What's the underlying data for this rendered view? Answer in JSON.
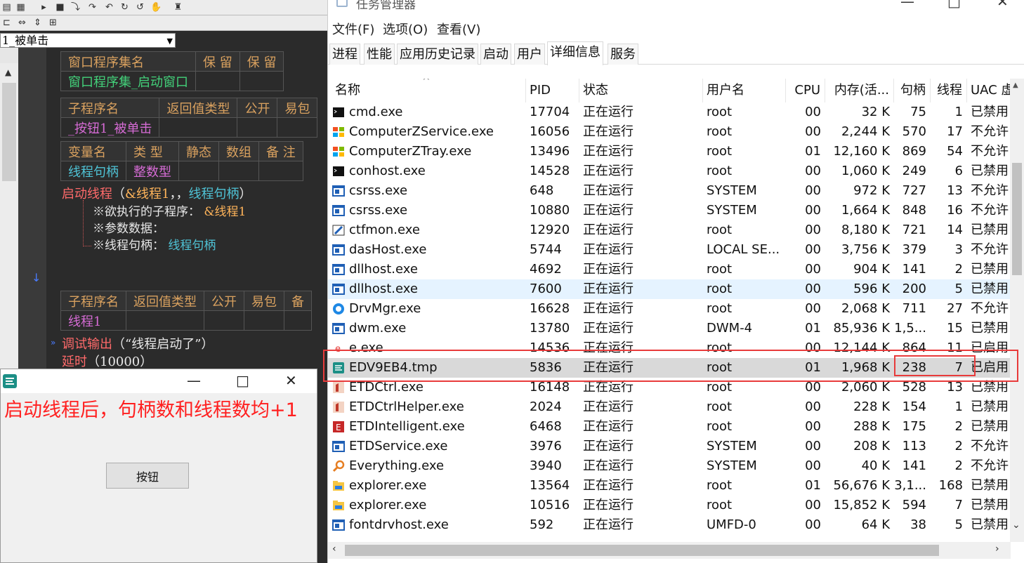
{
  "ide": {
    "combo_value": "1_被单击",
    "table1": {
      "headers": [
        "窗口程序集名",
        "保 留",
        "保 留"
      ],
      "row": [
        "窗口程序集_启动窗口"
      ]
    },
    "table2": {
      "headers": [
        "子程序名",
        "返回值类型",
        "公开",
        "易包"
      ],
      "row": [
        "_按钮1_被单击"
      ]
    },
    "table3": {
      "headers": [
        "变量名",
        "类 型",
        "静态",
        "数组",
        "备 注"
      ],
      "row": [
        "线程句柄",
        "整数型"
      ]
    },
    "code1": {
      "fn": "启动线程",
      "args_open": "（",
      "arg1": "&线程1",
      "sep": "，，",
      "arg2": "线程句柄",
      "args_close": "）"
    },
    "code_p1_label": "※欲执行的子程序：",
    "code_p1_val": "&线程1",
    "code_p2_label": "※参数数据：",
    "code_p3_label": "※线程句柄：",
    "code_p3_val": "线程句柄",
    "table4": {
      "headers": [
        "子程序名",
        "返回值类型",
        "公开",
        "易包",
        "备"
      ],
      "row": [
        "线程1"
      ]
    },
    "code2": {
      "fn": "调试输出",
      "arg": "（“线程启动了”）"
    },
    "code3": {
      "fn": "延时",
      "arg": "（10000）"
    }
  },
  "app_window": {
    "caption": "启动线程后，句柄数和线程数均+1",
    "button_label": "按钮",
    "minimize": "—",
    "maximize": "□",
    "close": "✕"
  },
  "task_manager": {
    "title": "任务管理器",
    "menu": [
      "文件(F)",
      "选项(O)",
      "查看(V)"
    ],
    "tabs": [
      "进程",
      "性能",
      "应用历史记录",
      "启动",
      "用户",
      "详细信息",
      "服务"
    ],
    "active_tab": "详细信息",
    "columns": [
      "名称",
      "PID",
      "状态",
      "用户名",
      "CPU",
      "内存(活...",
      "句柄",
      "线程",
      "UAC 虚"
    ],
    "rows": [
      {
        "name": "cmd.exe",
        "pid": "17704",
        "status": "正在运行",
        "user": "root",
        "cpu": "00",
        "mem": "32 K",
        "handles": "75",
        "threads": "1",
        "uac": "已禁用",
        "icon": "console-icon"
      },
      {
        "name": "ComputerZService.exe",
        "pid": "16056",
        "status": "正在运行",
        "user": "root",
        "cpu": "00",
        "mem": "2,244 K",
        "handles": "570",
        "threads": "17",
        "uac": "不允许",
        "icon": "windows-flag-icon"
      },
      {
        "name": "ComputerZTray.exe",
        "pid": "13496",
        "status": "正在运行",
        "user": "root",
        "cpu": "01",
        "mem": "12,160 K",
        "handles": "869",
        "threads": "54",
        "uac": "不允许",
        "icon": "windows-flag-icon"
      },
      {
        "name": "conhost.exe",
        "pid": "14528",
        "status": "正在运行",
        "user": "root",
        "cpu": "00",
        "mem": "1,060 K",
        "handles": "249",
        "threads": "6",
        "uac": "已禁用",
        "icon": "console-icon"
      },
      {
        "name": "csrss.exe",
        "pid": "648",
        "status": "正在运行",
        "user": "SYSTEM",
        "cpu": "00",
        "mem": "972 K",
        "handles": "727",
        "threads": "13",
        "uac": "不允许",
        "icon": "window-app-icon"
      },
      {
        "name": "csrss.exe",
        "pid": "10880",
        "status": "正在运行",
        "user": "SYSTEM",
        "cpu": "00",
        "mem": "1,664 K",
        "handles": "848",
        "threads": "16",
        "uac": "不允许",
        "icon": "window-app-icon"
      },
      {
        "name": "ctfmon.exe",
        "pid": "12920",
        "status": "正在运行",
        "user": "root",
        "cpu": "00",
        "mem": "8,180 K",
        "handles": "721",
        "threads": "14",
        "uac": "已禁用",
        "icon": "pen-icon"
      },
      {
        "name": "dasHost.exe",
        "pid": "5744",
        "status": "正在运行",
        "user": "LOCAL SE...",
        "cpu": "00",
        "mem": "3,756 K",
        "handles": "379",
        "threads": "3",
        "uac": "不允许",
        "icon": "window-app-icon"
      },
      {
        "name": "dllhost.exe",
        "pid": "4692",
        "status": "正在运行",
        "user": "root",
        "cpu": "00",
        "mem": "904 K",
        "handles": "141",
        "threads": "2",
        "uac": "已禁用",
        "icon": "window-app-icon"
      },
      {
        "name": "dllhost.exe",
        "pid": "7600",
        "status": "正在运行",
        "user": "root",
        "cpu": "00",
        "mem": "596 K",
        "handles": "200",
        "threads": "5",
        "uac": "已禁用",
        "icon": "window-app-icon"
      },
      {
        "name": "DrvMgr.exe",
        "pid": "16628",
        "status": "正在运行",
        "user": "root",
        "cpu": "00",
        "mem": "2,068 K",
        "handles": "711",
        "threads": "27",
        "uac": "不允许",
        "icon": "driver-icon"
      },
      {
        "name": "dwm.exe",
        "pid": "13780",
        "status": "正在运行",
        "user": "DWM-4",
        "cpu": "01",
        "mem": "85,936 K",
        "handles": "1,5...",
        "threads": "15",
        "uac": "已禁用",
        "icon": "window-app-icon"
      },
      {
        "name": "e.exe",
        "pid": "14536",
        "status": "正在运行",
        "user": "root",
        "cpu": "00",
        "mem": "12,144 K",
        "handles": "864",
        "threads": "11",
        "uac": "已启用",
        "icon": "e-lang-icon"
      },
      {
        "name": "EDV9EB4.tmp",
        "pid": "5836",
        "status": "正在运行",
        "user": "root",
        "cpu": "01",
        "mem": "1,968 K",
        "handles": "238",
        "threads": "7",
        "uac": "已启用",
        "icon": "e-lang-app-icon"
      },
      {
        "name": "ETDCtrl.exe",
        "pid": "16148",
        "status": "正在运行",
        "user": "root",
        "cpu": "00",
        "mem": "2,060 K",
        "handles": "528",
        "threads": "13",
        "uac": "已禁用",
        "icon": "touchpad-icon"
      },
      {
        "name": "ETDCtrlHelper.exe",
        "pid": "2024",
        "status": "正在运行",
        "user": "root",
        "cpu": "00",
        "mem": "228 K",
        "handles": "154",
        "threads": "1",
        "uac": "已禁用",
        "icon": "touchpad-icon"
      },
      {
        "name": "ETDIntelligent.exe",
        "pid": "6468",
        "status": "正在运行",
        "user": "root",
        "cpu": "00",
        "mem": "288 K",
        "handles": "175",
        "threads": "2",
        "uac": "已禁用",
        "icon": "etd-icon"
      },
      {
        "name": "ETDService.exe",
        "pid": "3976",
        "status": "正在运行",
        "user": "SYSTEM",
        "cpu": "00",
        "mem": "208 K",
        "handles": "113",
        "threads": "2",
        "uac": "不允许",
        "icon": "window-app-icon"
      },
      {
        "name": "Everything.exe",
        "pid": "3940",
        "status": "正在运行",
        "user": "SYSTEM",
        "cpu": "00",
        "mem": "40 K",
        "handles": "141",
        "threads": "2",
        "uac": "不允许",
        "icon": "magnifier-icon"
      },
      {
        "name": "explorer.exe",
        "pid": "13564",
        "status": "正在运行",
        "user": "root",
        "cpu": "01",
        "mem": "56,676 K",
        "handles": "3,1...",
        "threads": "168",
        "uac": "已禁用",
        "icon": "folder-icon"
      },
      {
        "name": "explorer.exe",
        "pid": "10516",
        "status": "正在运行",
        "user": "root",
        "cpu": "00",
        "mem": "15,852 K",
        "handles": "594",
        "threads": "7",
        "uac": "已禁用",
        "icon": "folder-icon"
      },
      {
        "name": "fontdrvhost.exe",
        "pid": "592",
        "status": "正在运行",
        "user": "UMFD-0",
        "cpu": "00",
        "mem": "64 K",
        "handles": "38",
        "threads": "5",
        "uac": "已禁用",
        "icon": "window-app-icon"
      }
    ],
    "selected_row": "EDV9EB4.tmp",
    "hover_row_pid": "7600"
  },
  "colors": {
    "highlight_border": "#e83b3b",
    "caption_red": "#ff2020"
  }
}
